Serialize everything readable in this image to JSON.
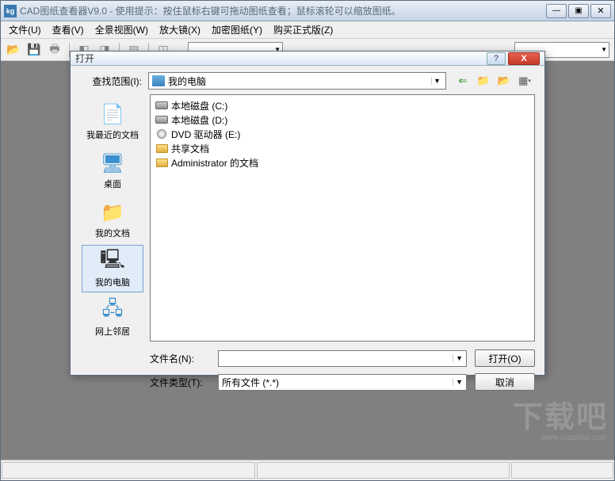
{
  "window": {
    "title": "CAD图纸查看器V9.0 - 使用提示：按住鼠标右键可拖动图纸查看；鼠标滚轮可以缩放图纸。",
    "icon_text": "kg"
  },
  "menu": {
    "file": "文件(U)",
    "view": "查看(V)",
    "panorama": "全景视图(W)",
    "magnifier": "放大镜(X)",
    "encrypt": "加密图纸(Y)",
    "buy": "购买正式版(Z)"
  },
  "dialog": {
    "title": "打开",
    "lookin_label": "查找范围(I):",
    "lookin_value": "我的电脑",
    "places": {
      "recent": "我最近的文档",
      "desktop": "桌面",
      "mydocs": "我的文档",
      "mycomputer": "我的电脑",
      "network": "网上邻居"
    },
    "files": [
      {
        "type": "drive",
        "label": "本地磁盘 (C:)"
      },
      {
        "type": "drive",
        "label": "本地磁盘 (D:)"
      },
      {
        "type": "dvd",
        "label": "DVD 驱动器 (E:)"
      },
      {
        "type": "folder",
        "label": "共享文档"
      },
      {
        "type": "folder",
        "label": "Administrator 的文档"
      }
    ],
    "filename_label": "文件名(N):",
    "filename_value": "",
    "filetype_label": "文件类型(T):",
    "filetype_value": "所有文件 (*.*)",
    "open_btn": "打开(O)",
    "cancel_btn": "取消"
  },
  "watermark": {
    "big": "下载吧",
    "small": "www.xiazaiba.com"
  }
}
